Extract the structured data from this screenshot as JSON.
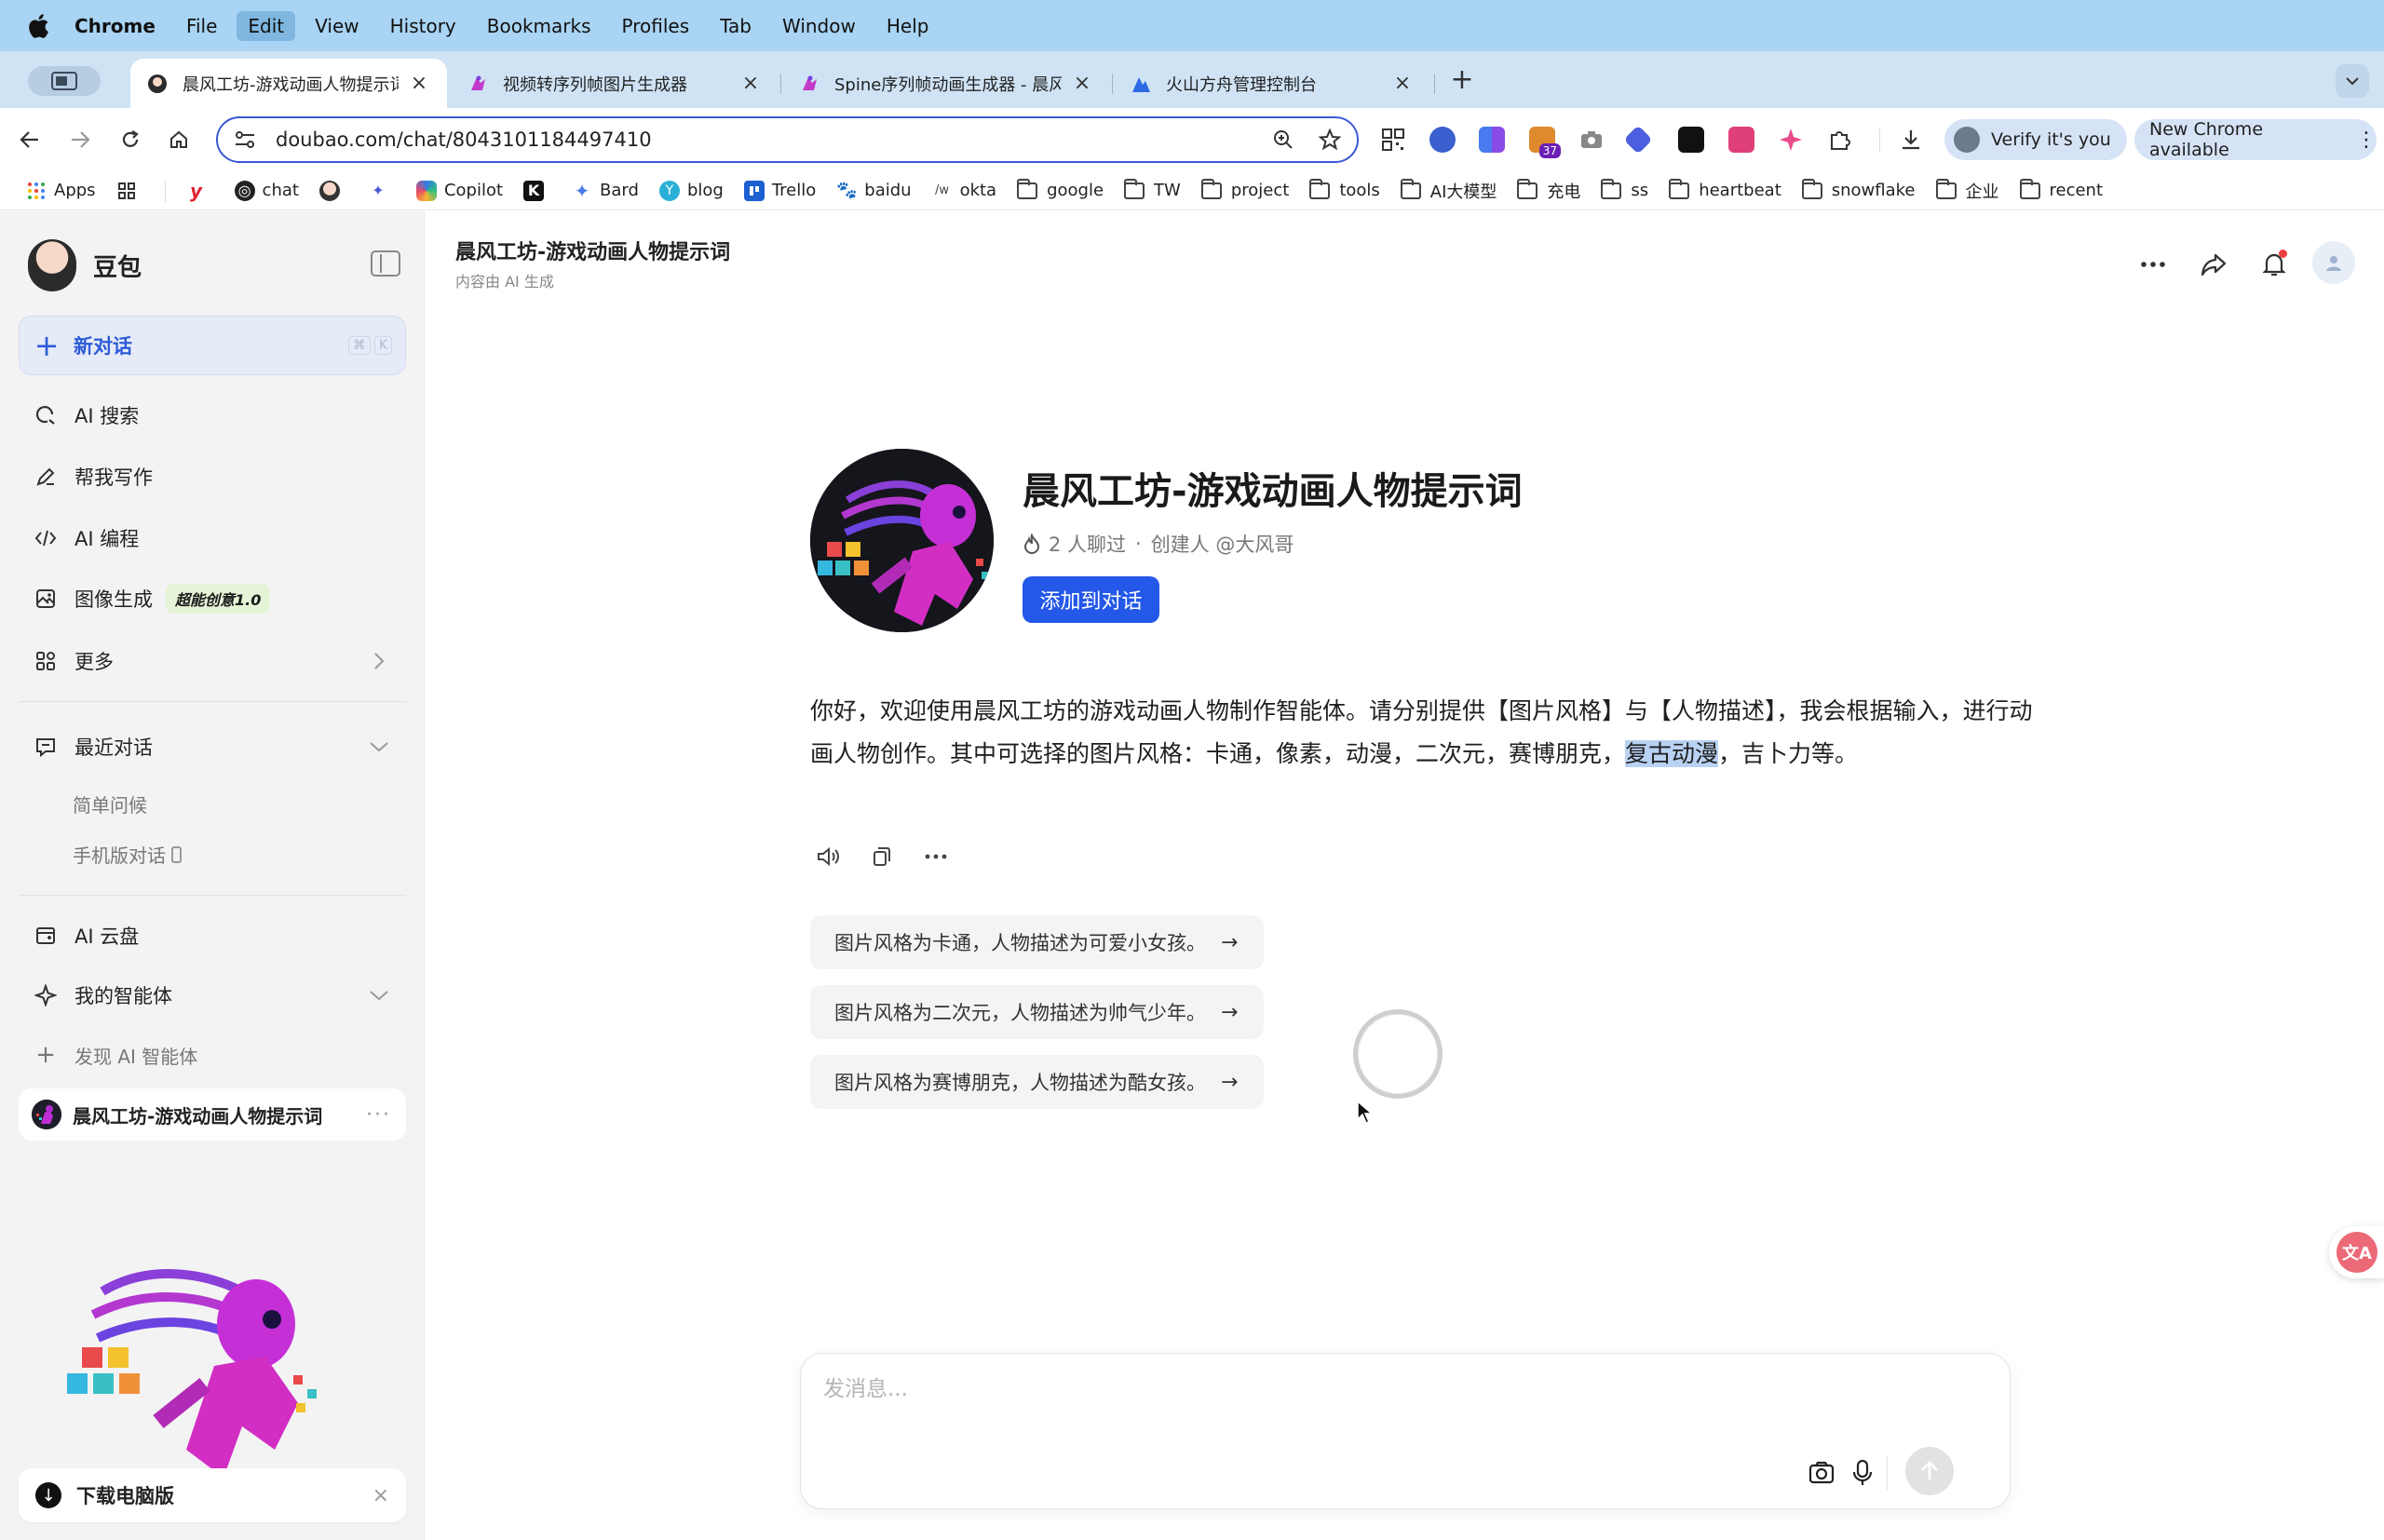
{
  "menubar": {
    "items": [
      "Chrome",
      "File",
      "Edit",
      "View",
      "History",
      "Bookmarks",
      "Profiles",
      "Tab",
      "Window",
      "Help"
    ]
  },
  "tabs": [
    {
      "title": "晨风工坊-游戏动画人物提示词 -",
      "active": true
    },
    {
      "title": "视频转序列帧图片生成器",
      "active": false
    },
    {
      "title": "Spine序列帧动画生成器 - 晨风工...",
      "active": false
    },
    {
      "title": "火山方舟管理控制台",
      "active": false
    }
  ],
  "toolbar": {
    "url": "doubao.com/chat/8043101184497410",
    "verify_label": "Verify it's you",
    "update_label": "New Chrome available",
    "extension_badge": "37"
  },
  "bookmarks": [
    {
      "label": "Apps",
      "type": "apps"
    },
    {
      "label": "chat",
      "type": "site"
    },
    {
      "label": "Copilot",
      "type": "site"
    },
    {
      "label": "Bard",
      "type": "site"
    },
    {
      "label": "blog",
      "type": "site"
    },
    {
      "label": "Trello",
      "type": "site"
    },
    {
      "label": "baidu",
      "type": "site"
    },
    {
      "label": "okta",
      "type": "site"
    },
    {
      "label": "google",
      "type": "folder"
    },
    {
      "label": "TW",
      "type": "folder"
    },
    {
      "label": "project",
      "type": "folder"
    },
    {
      "label": "tools",
      "type": "folder"
    },
    {
      "label": "AI大模型",
      "type": "folder"
    },
    {
      "label": "充电",
      "type": "folder"
    },
    {
      "label": "ss",
      "type": "folder"
    },
    {
      "label": "heartbeat",
      "type": "folder"
    },
    {
      "label": "snowflake",
      "type": "folder"
    },
    {
      "label": "企业",
      "type": "folder"
    },
    {
      "label": "recent",
      "type": "folder"
    }
  ],
  "sidebar": {
    "brand": "豆包",
    "new_chat": "新对话",
    "new_chat_keys": [
      "⌘",
      "K"
    ],
    "items": [
      {
        "label": "AI 搜索"
      },
      {
        "label": "帮我写作"
      },
      {
        "label": "AI 编程"
      },
      {
        "label": "图像生成",
        "badge": "超能创意1.0"
      },
      {
        "label": "更多"
      }
    ],
    "recent_label": "最近对话",
    "recent": [
      "简单问候",
      "手机版对话"
    ],
    "cloud": "AI 云盘",
    "my_agents": "我的智能体",
    "discover": "发现 AI 智能体",
    "active_agent": "晨风工坊-游戏动画人物提示词",
    "download": "下载电脑版"
  },
  "header": {
    "title": "晨风工坊-游戏动画人物提示词",
    "subtitle": "内容由 AI 生成"
  },
  "agent": {
    "name": "晨风工坊-游戏动画人物提示词",
    "chatted": "2 人聊过",
    "separator": "·",
    "creator": "创建人 @大风哥",
    "add_button": "添加到对话"
  },
  "message": {
    "before": "你好，欢迎使用晨风工坊的游戏动画人物制作智能体。请分别提供【图片风格】与【人物描述】，我会根据输入，进行动画人物创作。其中可选择的图片风格：卡通，像素，动漫，二次元，赛博朋克，",
    "highlight": "复古动漫",
    "after": "，吉卜力等。"
  },
  "suggestions": [
    "图片风格为卡通，人物描述为可爱小女孩。",
    "图片风格为二次元，人物描述为帅气少年。",
    "图片风格为赛博朋克，人物描述为酷女孩。"
  ],
  "composer": {
    "placeholder": "发消息..."
  },
  "colors": {
    "accent": "#2458e8",
    "menubar": "#a9d4f3",
    "tabstrip": "#cfe3f5",
    "sidebar_bg": "#f3f3f4"
  }
}
